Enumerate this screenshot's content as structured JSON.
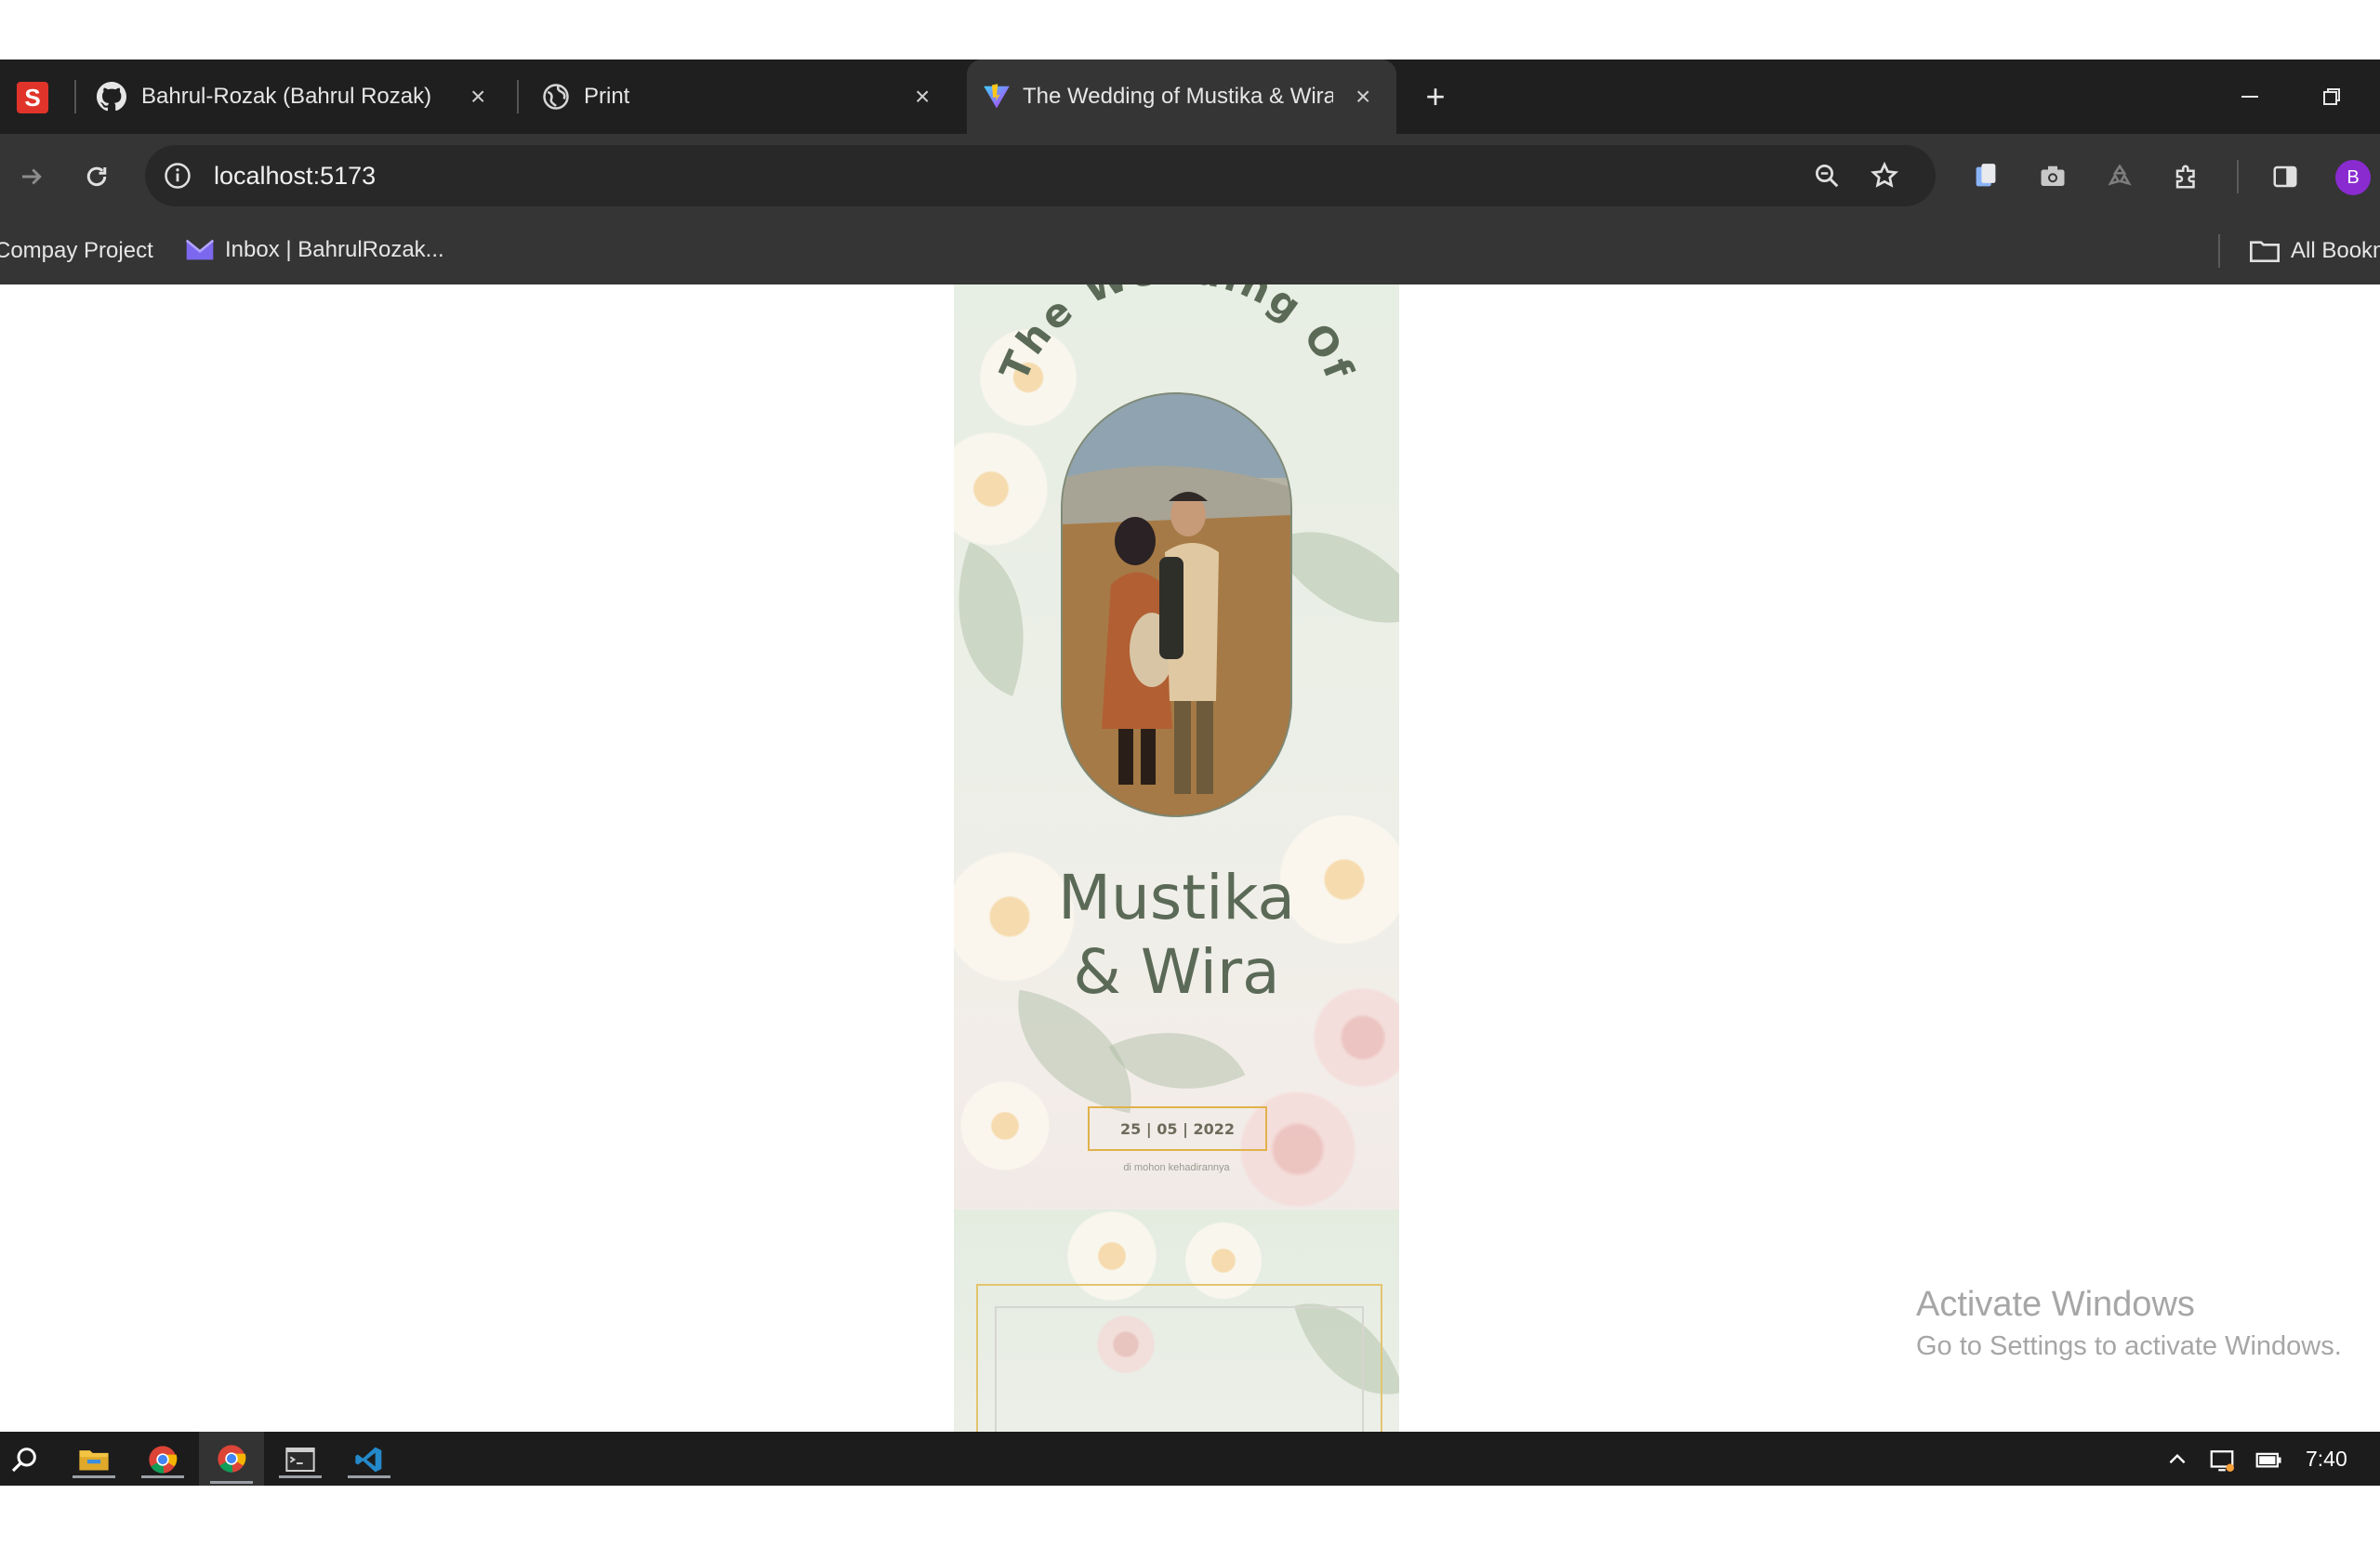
{
  "browser": {
    "tabs": [
      {
        "title": "Bahrul-Rozak (Bahrul Rozak)",
        "icon": "github-icon"
      },
      {
        "title": "Print",
        "icon": "globe-icon"
      },
      {
        "title": "The Wedding of Mustika & Wira",
        "icon": "vite-icon",
        "active": true
      }
    ],
    "new_tab": "+",
    "address": "localhost:5173",
    "bookmarks": [
      {
        "label": "Compay Project"
      },
      {
        "label": "Inbox | BahrulRozak..."
      }
    ],
    "all_bookmarks": "All Bookmarks",
    "profile_initial": "B"
  },
  "invitation": {
    "arc_title": "The Wedding Of",
    "names_line1": "Mustika",
    "names_line2": "& Wira",
    "date": "25 | 05 | 2022",
    "note": "di mohon kehadirannya"
  },
  "watermark": {
    "title": "Activate Windows",
    "subtitle": "Go to Settings to activate Windows."
  },
  "taskbar": {
    "time": "7:40"
  },
  "colors": {
    "tabstrip": "#1f1f1f",
    "toolbar": "#353535",
    "names": "#5b6a57",
    "date_border": "#e0b24a"
  }
}
